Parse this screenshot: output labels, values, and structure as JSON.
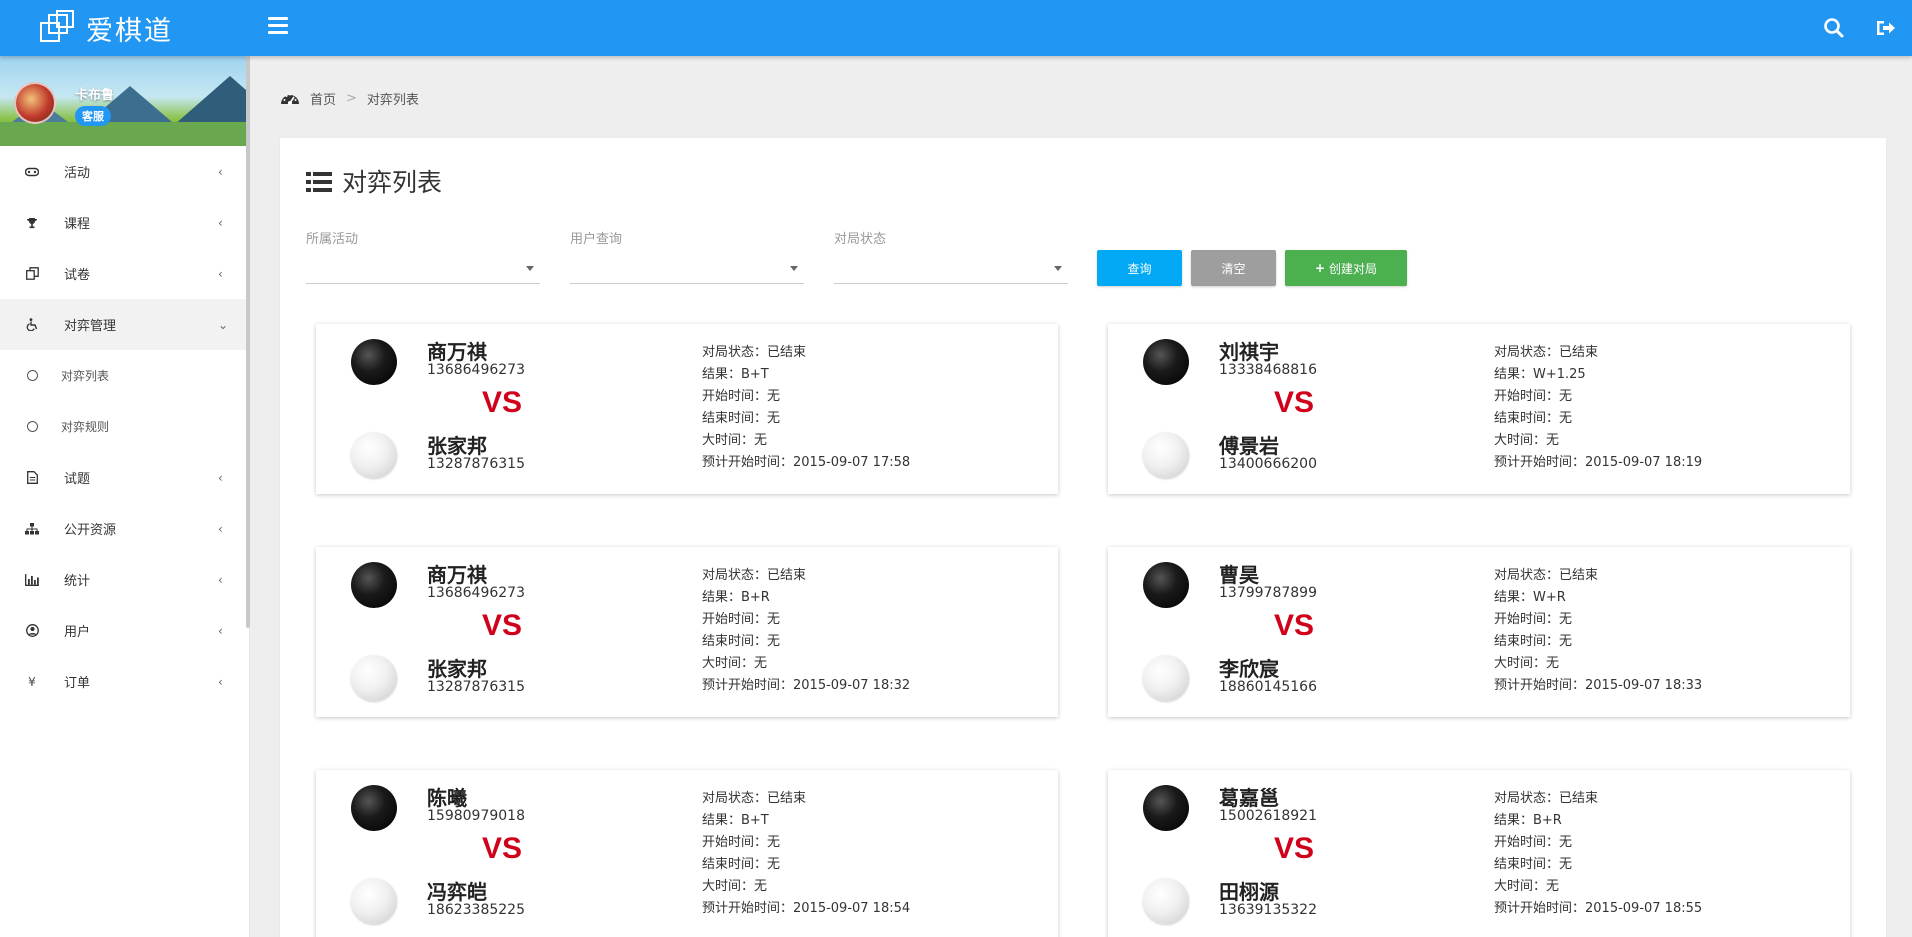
{
  "app": {
    "title": "爱棋道"
  },
  "profile": {
    "name": "卡布鲁",
    "role": "客服"
  },
  "menu": {
    "items": [
      {
        "label": "活动",
        "icon": "gamepad-icon",
        "arrow": "‹"
      },
      {
        "label": "课程",
        "icon": "trophy-icon",
        "arrow": "‹"
      },
      {
        "label": "试卷",
        "icon": "copy-icon",
        "arrow": "‹"
      },
      {
        "label": "对弈管理",
        "icon": "wheelchair-icon",
        "arrow": "⌄"
      },
      {
        "label": "对弈列表",
        "icon": "circle-icon"
      },
      {
        "label": "对弈规则",
        "icon": "circle-icon"
      },
      {
        "label": "试题",
        "icon": "document-icon",
        "arrow": "‹"
      },
      {
        "label": "公开资源",
        "icon": "sitemap-icon",
        "arrow": "‹"
      },
      {
        "label": "统计",
        "icon": "bar-chart-icon",
        "arrow": "‹"
      },
      {
        "label": "用户",
        "icon": "user-circle-icon",
        "arrow": "‹"
      },
      {
        "label": "订单",
        "icon": "yen-icon",
        "glyph": "¥",
        "arrow": "‹"
      }
    ]
  },
  "breadcrumb": {
    "home": "首页",
    "separator": ">",
    "current": "对弈列表"
  },
  "panel": {
    "title": "对弈列表"
  },
  "filters": {
    "activity_label": "所属活动",
    "user_label": "用户查询",
    "status_label": "对局状态"
  },
  "buttons": {
    "query": "查询",
    "clear": "清空",
    "create": "创建对局"
  },
  "matches": [
    {
      "black_name": "商万祺",
      "black_phone": "13686496273",
      "white_name": "张家邦",
      "white_phone": "13287876315",
      "vs": "VS",
      "status": "对局状态：已结束",
      "result": "结果：B+T",
      "start": "开始时间：无",
      "end": "结束时间：无",
      "main_time": "大时间：无",
      "scheduled": "预计开始时间：2015-09-07 17:58"
    },
    {
      "black_name": "刘祺宇",
      "black_phone": "13338468816",
      "white_name": "傅景岩",
      "white_phone": "13400666200",
      "vs": "VS",
      "status": "对局状态：已结束",
      "result": "结果：W+1.25",
      "start": "开始时间：无",
      "end": "结束时间：无",
      "main_time": "大时间：无",
      "scheduled": "预计开始时间：2015-09-07 18:19"
    },
    {
      "black_name": "商万祺",
      "black_phone": "13686496273",
      "white_name": "张家邦",
      "white_phone": "13287876315",
      "vs": "VS",
      "status": "对局状态：已结束",
      "result": "结果：B+R",
      "start": "开始时间：无",
      "end": "结束时间：无",
      "main_time": "大时间：无",
      "scheduled": "预计开始时间：2015-09-07 18:32"
    },
    {
      "black_name": "曹昊",
      "black_phone": "13799787899",
      "white_name": "李欣宸",
      "white_phone": "18860145166",
      "vs": "VS",
      "status": "对局状态：已结束",
      "result": "结果：W+R",
      "start": "开始时间：无",
      "end": "结束时间：无",
      "main_time": "大时间：无",
      "scheduled": "预计开始时间：2015-09-07 18:33"
    },
    {
      "black_name": "陈曦",
      "black_phone": "15980979018",
      "white_name": "冯弈皑",
      "white_phone": "18623385225",
      "vs": "VS",
      "status": "对局状态：已结束",
      "result": "结果：B+T",
      "start": "开始时间：无",
      "end": "结束时间：无",
      "main_time": "大时间：无",
      "scheduled": "预计开始时间：2015-09-07 18:54"
    },
    {
      "black_name": "葛嘉邕",
      "black_phone": "15002618921",
      "white_name": "田栩源",
      "white_phone": "13639135322",
      "vs": "VS",
      "status": "对局状态：已结束",
      "result": "结果：B+R",
      "start": "开始时间：无",
      "end": "结束时间：无",
      "main_time": "大时间：无",
      "scheduled": "预计开始时间：2015-09-07 18:55"
    }
  ],
  "colors": {
    "topbar": "#2196f3",
    "query_button": "#03a9f4",
    "clear_button": "#9e9e9e",
    "create_button": "#4caf50",
    "vs_text": "#d0021b"
  }
}
